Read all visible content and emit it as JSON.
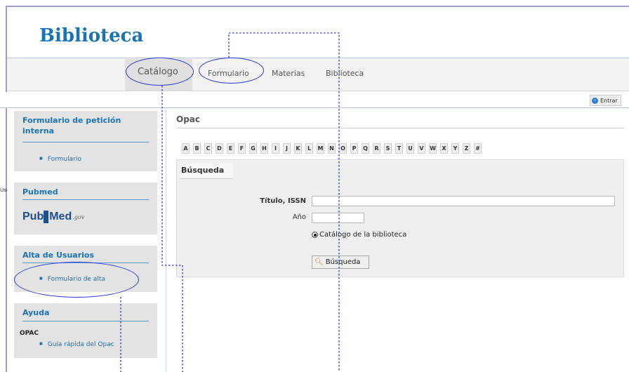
{
  "brand": "Biblioteca",
  "nav": {
    "items": [
      {
        "label": "Catálogo"
      },
      {
        "label": "Formulario"
      },
      {
        "label": "Materias"
      },
      {
        "label": "Biblioteca"
      }
    ]
  },
  "userbar": {
    "label": "Usuarios",
    "login_label": "Entrar"
  },
  "sidebar": {
    "boxes": [
      {
        "title": "Formulario de petición interna",
        "links": [
          "Formulario"
        ]
      },
      {
        "title": "Pubmed",
        "logo": {
          "pub": "Pub",
          "med": "Med",
          "gov": ".gov"
        }
      },
      {
        "title": "Alta de Usuarios",
        "links": [
          "Formulario de alta"
        ]
      },
      {
        "title": "Ayuda",
        "subtitle": "OPAC",
        "links": [
          "Guía rápida del Opac"
        ]
      }
    ]
  },
  "main": {
    "title": "Opac",
    "alphabet": [
      "A",
      "B",
      "C",
      "D",
      "E",
      "F",
      "G",
      "H",
      "I",
      "J",
      "K",
      "L",
      "M",
      "N",
      "O",
      "P",
      "Q",
      "R",
      "S",
      "T",
      "U",
      "V",
      "W",
      "X",
      "Y",
      "Z",
      "#"
    ],
    "search": {
      "tab_label": "Búsqueda",
      "title_label": "Título, ISSN",
      "title_value": "",
      "year_label": "Año",
      "year_value": "",
      "radio_label": "Catálogo de la biblioteca",
      "button_label": "Búsqueda"
    }
  },
  "colors": {
    "brand": "#1a73b5",
    "annotation": "#2a35d8"
  }
}
